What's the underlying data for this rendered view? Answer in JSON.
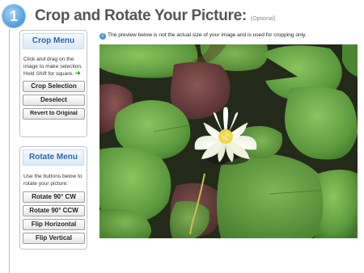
{
  "step": {
    "number": "1"
  },
  "header": {
    "title": "Crop and Rotate Your Picture:",
    "optional": "(Optional)"
  },
  "notice": {
    "text": "The preview below is not the actual size of your image and is used for cropping only."
  },
  "crop_menu": {
    "title": "Crop Menu",
    "instructions_1": "Click and drag on the image to make selection. Hold ",
    "instructions_key": "Shift",
    "instructions_2": " for square.",
    "buttons": {
      "crop_selection": "Crop Selection",
      "deselect": "Deselect",
      "revert": "Revert to Original"
    }
  },
  "rotate_menu": {
    "title": "Rotate Menu",
    "instructions": "Use the buttons below to rotate your picture:",
    "buttons": {
      "rotate_cw": "Rotate 90° CW",
      "rotate_ccw": "Rotate 90° CCW",
      "flip_horizontal": "Flip Horizontal",
      "flip_vertical": "Flip Vertical"
    }
  },
  "colors": {
    "accent": "#2f67a7",
    "badge": "#5ea9e3",
    "title": "#555555",
    "pad_green": "#5d9a3e",
    "pad_red": "#6e3a3a",
    "water": "#27301d",
    "flower": "#fbfbf2"
  },
  "icons": {
    "info": "info-icon",
    "arrow": "arrow-right-icon"
  }
}
